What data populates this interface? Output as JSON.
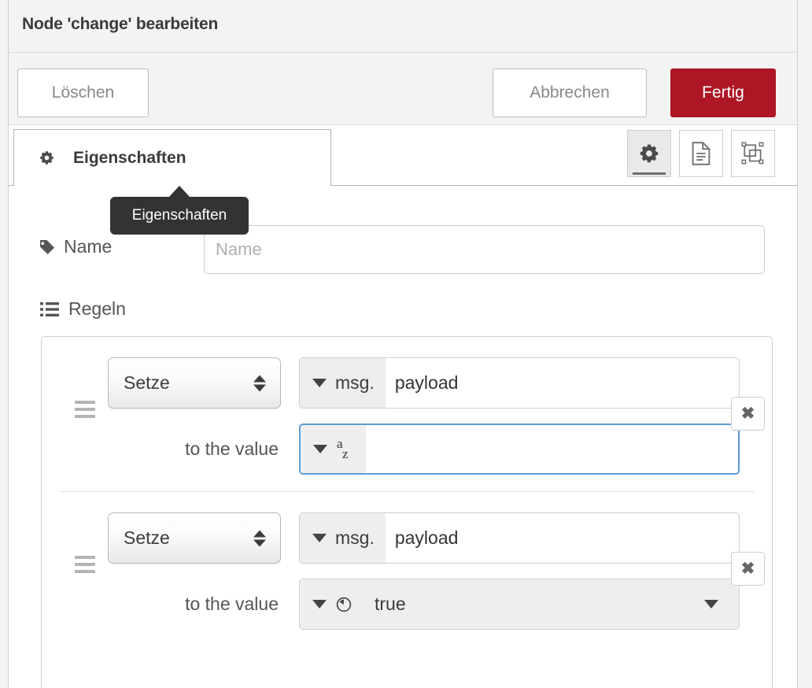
{
  "header": {
    "title": "Node 'change' bearbeiten"
  },
  "toolbar": {
    "delete_label": "Löschen",
    "cancel_label": "Abbrechen",
    "done_label": "Fertig",
    "done_color": "#ad1625"
  },
  "tabs": [
    {
      "label": "Eigenschaften",
      "icon": "gear-icon",
      "active": true
    }
  ],
  "tooltip": {
    "text": "Eigenschaften"
  },
  "panel_buttons": [
    {
      "icon": "gear-icon",
      "name": "properties-panel-button",
      "selected": true
    },
    {
      "icon": "file-lines-icon",
      "name": "description-panel-button",
      "selected": false
    },
    {
      "icon": "appearance-icon",
      "name": "appearance-panel-button",
      "selected": false
    }
  ],
  "form": {
    "name": {
      "label": "Name",
      "icon": "tag-icon",
      "value": "",
      "placeholder": "Name"
    },
    "rules": {
      "label": "Regeln",
      "icon": "list-icon",
      "to_the_value_label": "to the value",
      "remove_label": "✖",
      "items": [
        {
          "action": "Setze",
          "target_type_prefix": "msg.",
          "target_type_icon": "chevron-down-icon",
          "target_value": "payload",
          "value_type_icon": "az-string-icon",
          "value": "",
          "value_focused": true,
          "value_kind": "string"
        },
        {
          "action": "Setze",
          "target_type_prefix": "msg.",
          "target_type_icon": "chevron-down-icon",
          "target_value": "payload",
          "value_type_icon": "boolean-icon",
          "value": "true",
          "value_focused": false,
          "value_kind": "boolean"
        }
      ]
    }
  }
}
